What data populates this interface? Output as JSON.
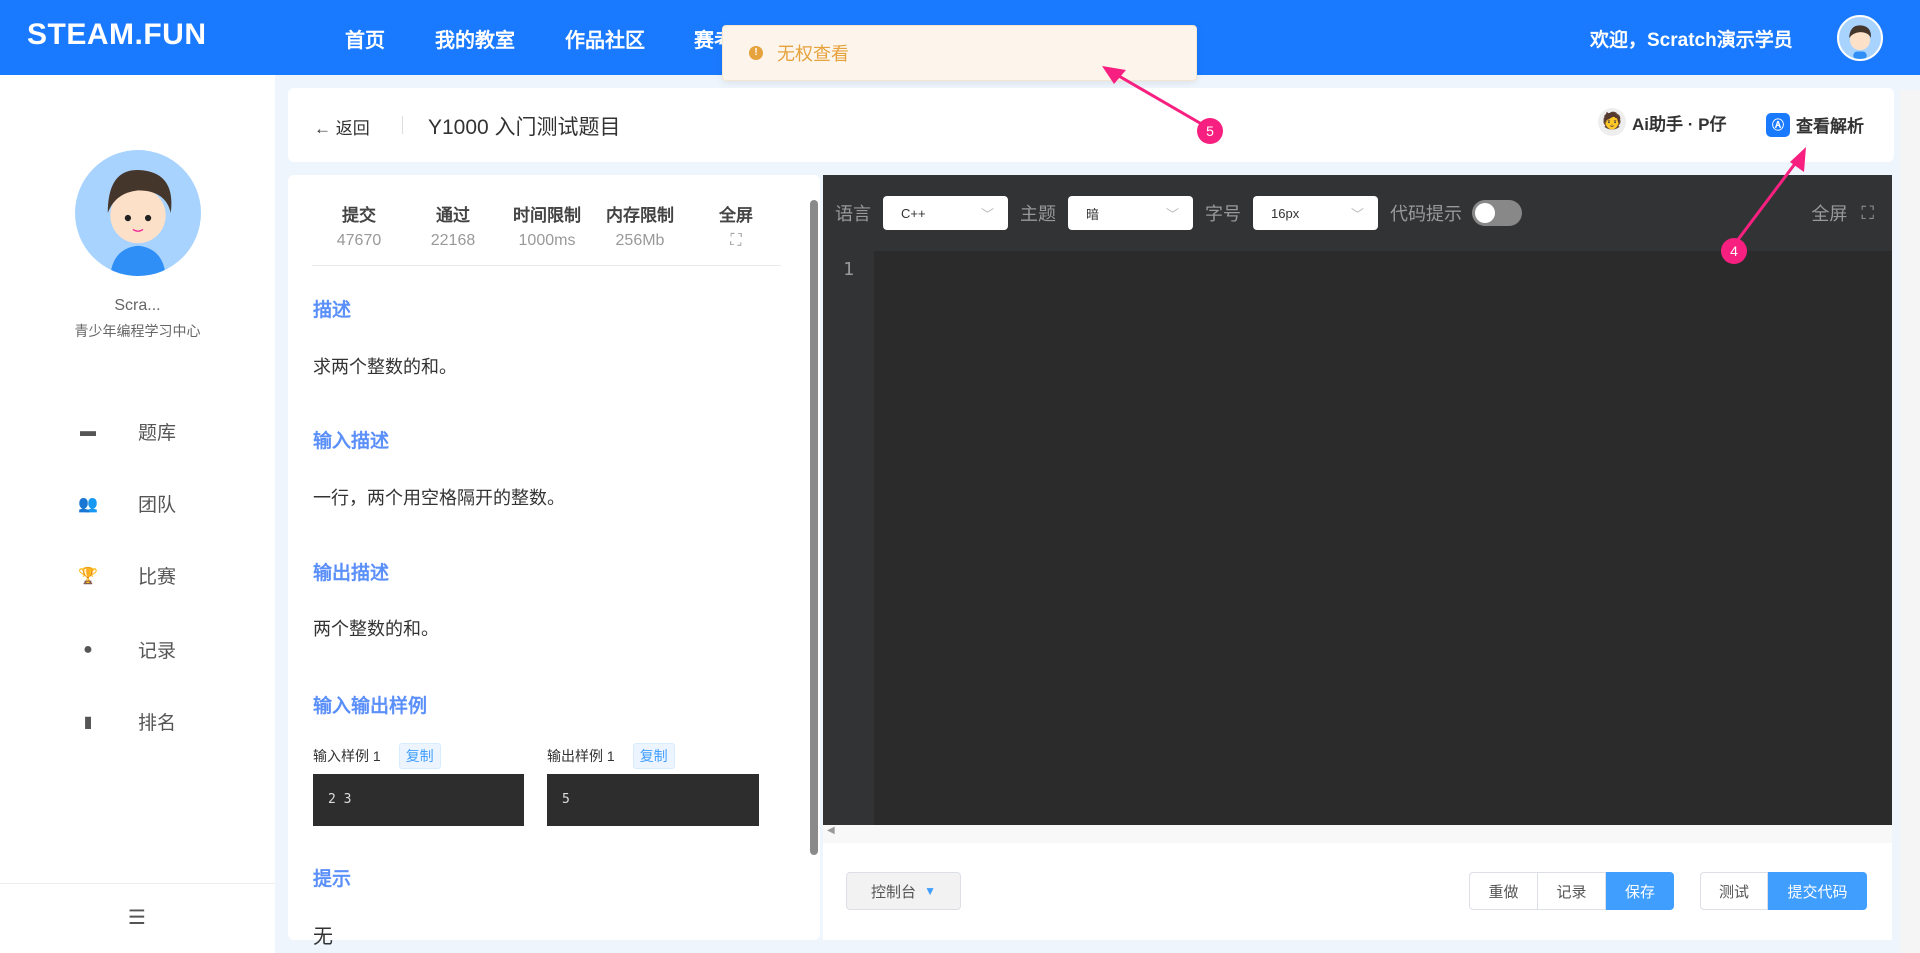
{
  "header": {
    "logo": "STEAM.FUN",
    "nav": [
      "首页",
      "我的教室",
      "作品社区",
      "赛考"
    ],
    "welcome": "欢迎，Scratch演示学员"
  },
  "toast": {
    "message": "无权查看",
    "icon": "warning-icon"
  },
  "sidebar": {
    "user_name": "Scra...",
    "org": "青少年编程学习中心",
    "items": [
      {
        "label": "题库",
        "icon": "hat-icon"
      },
      {
        "label": "团队",
        "icon": "team-icon"
      },
      {
        "label": "比赛",
        "icon": "trophy-icon"
      },
      {
        "label": "记录",
        "icon": "clock-icon"
      },
      {
        "label": "排名",
        "icon": "bar-chart-icon"
      }
    ]
  },
  "topbar": {
    "back": "返回",
    "title": "Y1000 入门测试题目",
    "ai": "Ai助手 · P仔",
    "analysis": "查看解析"
  },
  "problem": {
    "stats": [
      {
        "label": "提交",
        "value": "47670"
      },
      {
        "label": "通过",
        "value": "22168"
      },
      {
        "label": "时间限制",
        "value": "1000ms"
      },
      {
        "label": "内存限制",
        "value": "256Mb"
      },
      {
        "label": "全屏",
        "value": "⛶"
      }
    ],
    "desc_title": "描述",
    "desc": "求两个整数的和。",
    "input_title": "输入描述",
    "input": "一行，两个用空格隔开的整数。",
    "output_title": "输出描述",
    "output": "两个整数的和。",
    "samples_title": "输入输出样例",
    "sample_in_label": "输入样例 1",
    "sample_out_label": "输出样例 1",
    "copy": "复制",
    "sample_in": "2 3",
    "sample_out": "5",
    "hint_title": "提示",
    "hint": "无"
  },
  "editor": {
    "lang_label": "语言",
    "lang": "C++",
    "theme_label": "主题",
    "theme": "暗",
    "font_label": "字号",
    "font": "16px",
    "hint_label": "代码提示",
    "hint_on": false,
    "fullscreen": "全屏",
    "line": "1"
  },
  "actions": {
    "console": "控制台",
    "redo": "重做",
    "record": "记录",
    "save": "保存",
    "test": "测试",
    "submit": "提交代码"
  },
  "annotations": [
    "5",
    "4"
  ]
}
